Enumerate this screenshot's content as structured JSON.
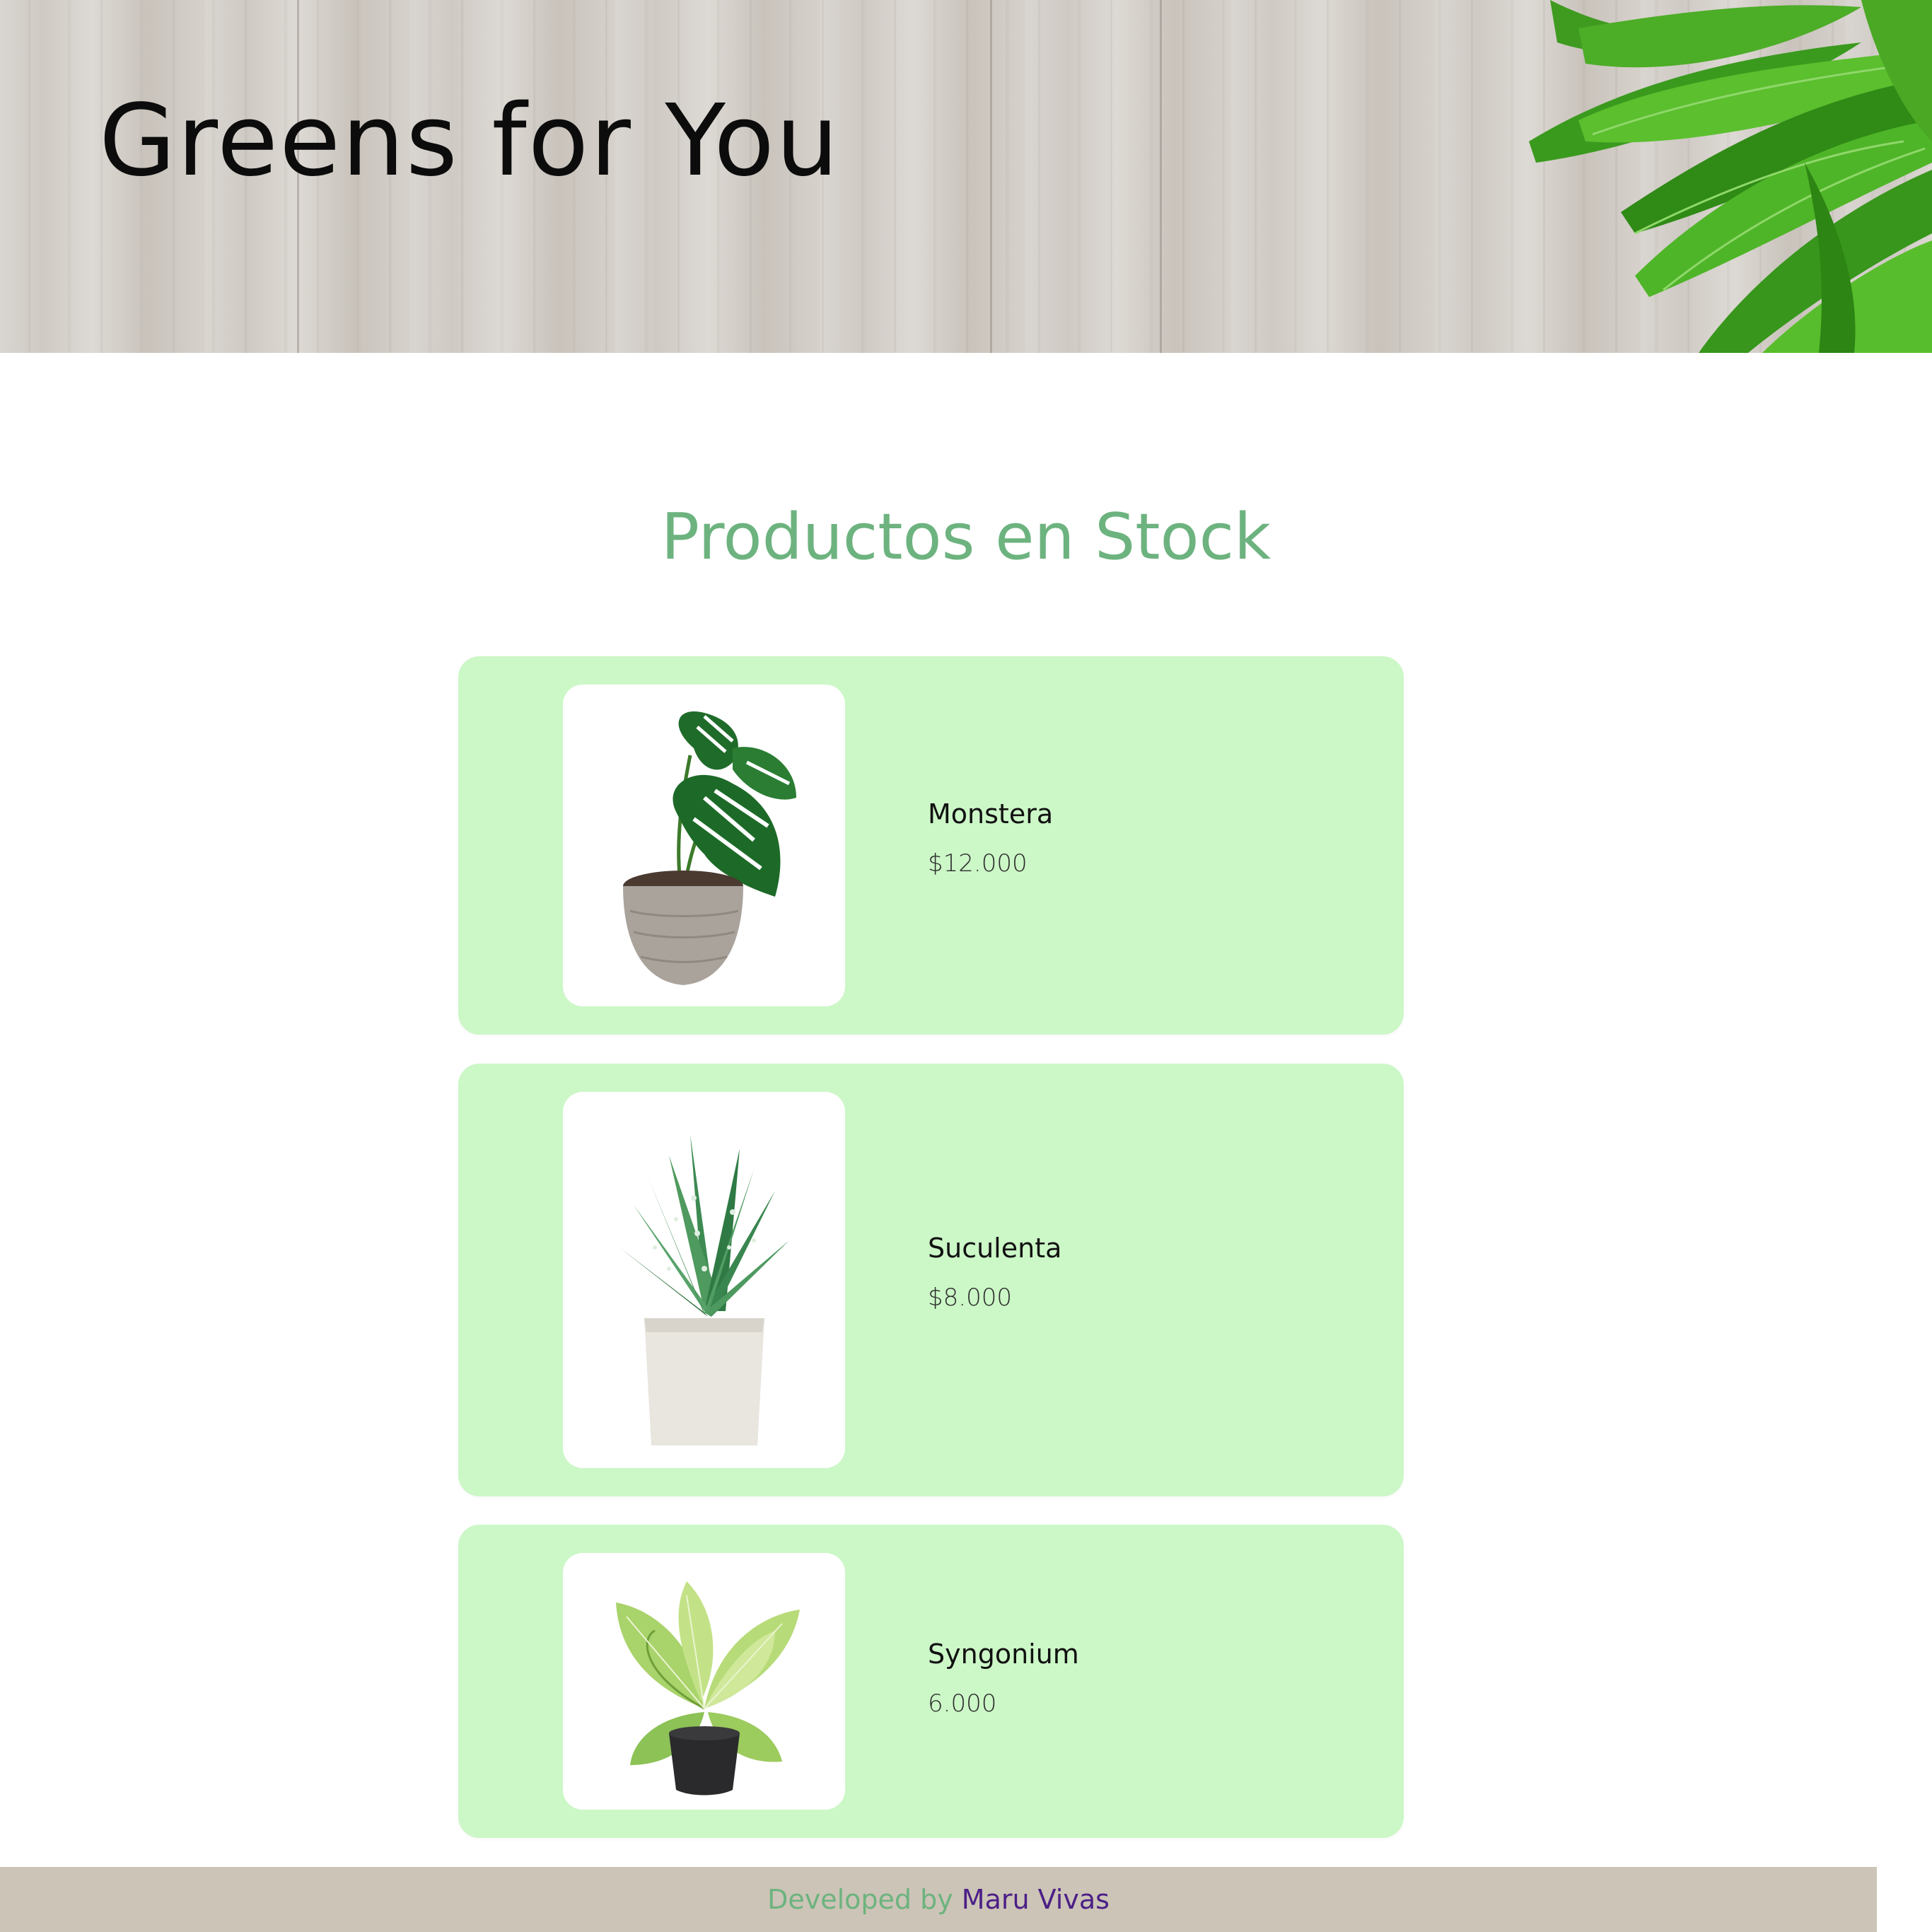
{
  "site": {
    "title": "Greens for You"
  },
  "main": {
    "section_title": "Productos en Stock",
    "products": [
      {
        "name": "Monstera",
        "price": "$12.000",
        "image": "monstera-plant-image"
      },
      {
        "name": "Suculenta",
        "price": "$8.000",
        "image": "succulent-plant-image"
      },
      {
        "name": "Syngonium",
        "price": "6.000",
        "image": "syngonium-plant-image"
      }
    ]
  },
  "footer": {
    "prefix": "Developed by",
    "author": "Maru Vivas"
  },
  "colors": {
    "card_background": "#ccf7c7",
    "section_title": "#6db37f",
    "footer_background": "#ccc4b7",
    "footer_text": "#6db37f",
    "footer_link": "#4b1f86"
  }
}
